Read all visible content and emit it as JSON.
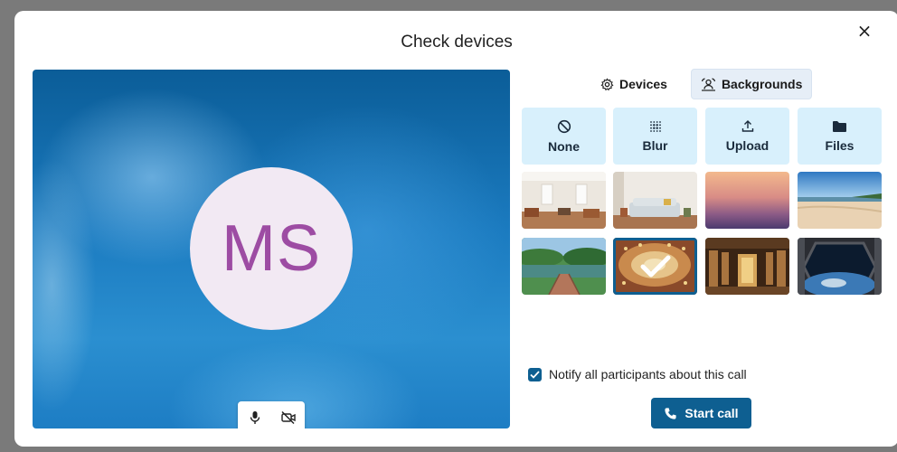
{
  "dialog": {
    "title": "Check devices",
    "close_label": "×"
  },
  "preview": {
    "avatar_initials": "MS",
    "avatar_bg": "#f2e9f3",
    "avatar_color": "#9d4ca3",
    "mic_icon": "microphone-icon",
    "camera_icon": "camera-off-icon"
  },
  "tabs": [
    {
      "label": "Devices",
      "icon": "gear-icon",
      "active": false
    },
    {
      "label": "Backgrounds",
      "icon": "backgrounds-icon",
      "active": true
    }
  ],
  "background_options": [
    {
      "label": "None",
      "icon": "none-icon"
    },
    {
      "label": "Blur",
      "icon": "blur-icon"
    },
    {
      "label": "Upload",
      "icon": "upload-icon"
    },
    {
      "label": "Files",
      "icon": "folder-icon"
    }
  ],
  "background_images": [
    {
      "name": "office-room",
      "selected": false
    },
    {
      "name": "living-room",
      "selected": false
    },
    {
      "name": "sunset-gradient",
      "selected": false
    },
    {
      "name": "beach",
      "selected": false
    },
    {
      "name": "garden-bridge",
      "selected": false
    },
    {
      "name": "theater-ceiling",
      "selected": true
    },
    {
      "name": "library",
      "selected": false
    },
    {
      "name": "space-station",
      "selected": false
    }
  ],
  "notify": {
    "label": "Notify all participants about this call",
    "checked": true
  },
  "start_call": {
    "label": "Start call",
    "icon": "phone-icon"
  },
  "colors": {
    "accent": "#0e5f91",
    "option_bg": "#d8f0fc"
  }
}
